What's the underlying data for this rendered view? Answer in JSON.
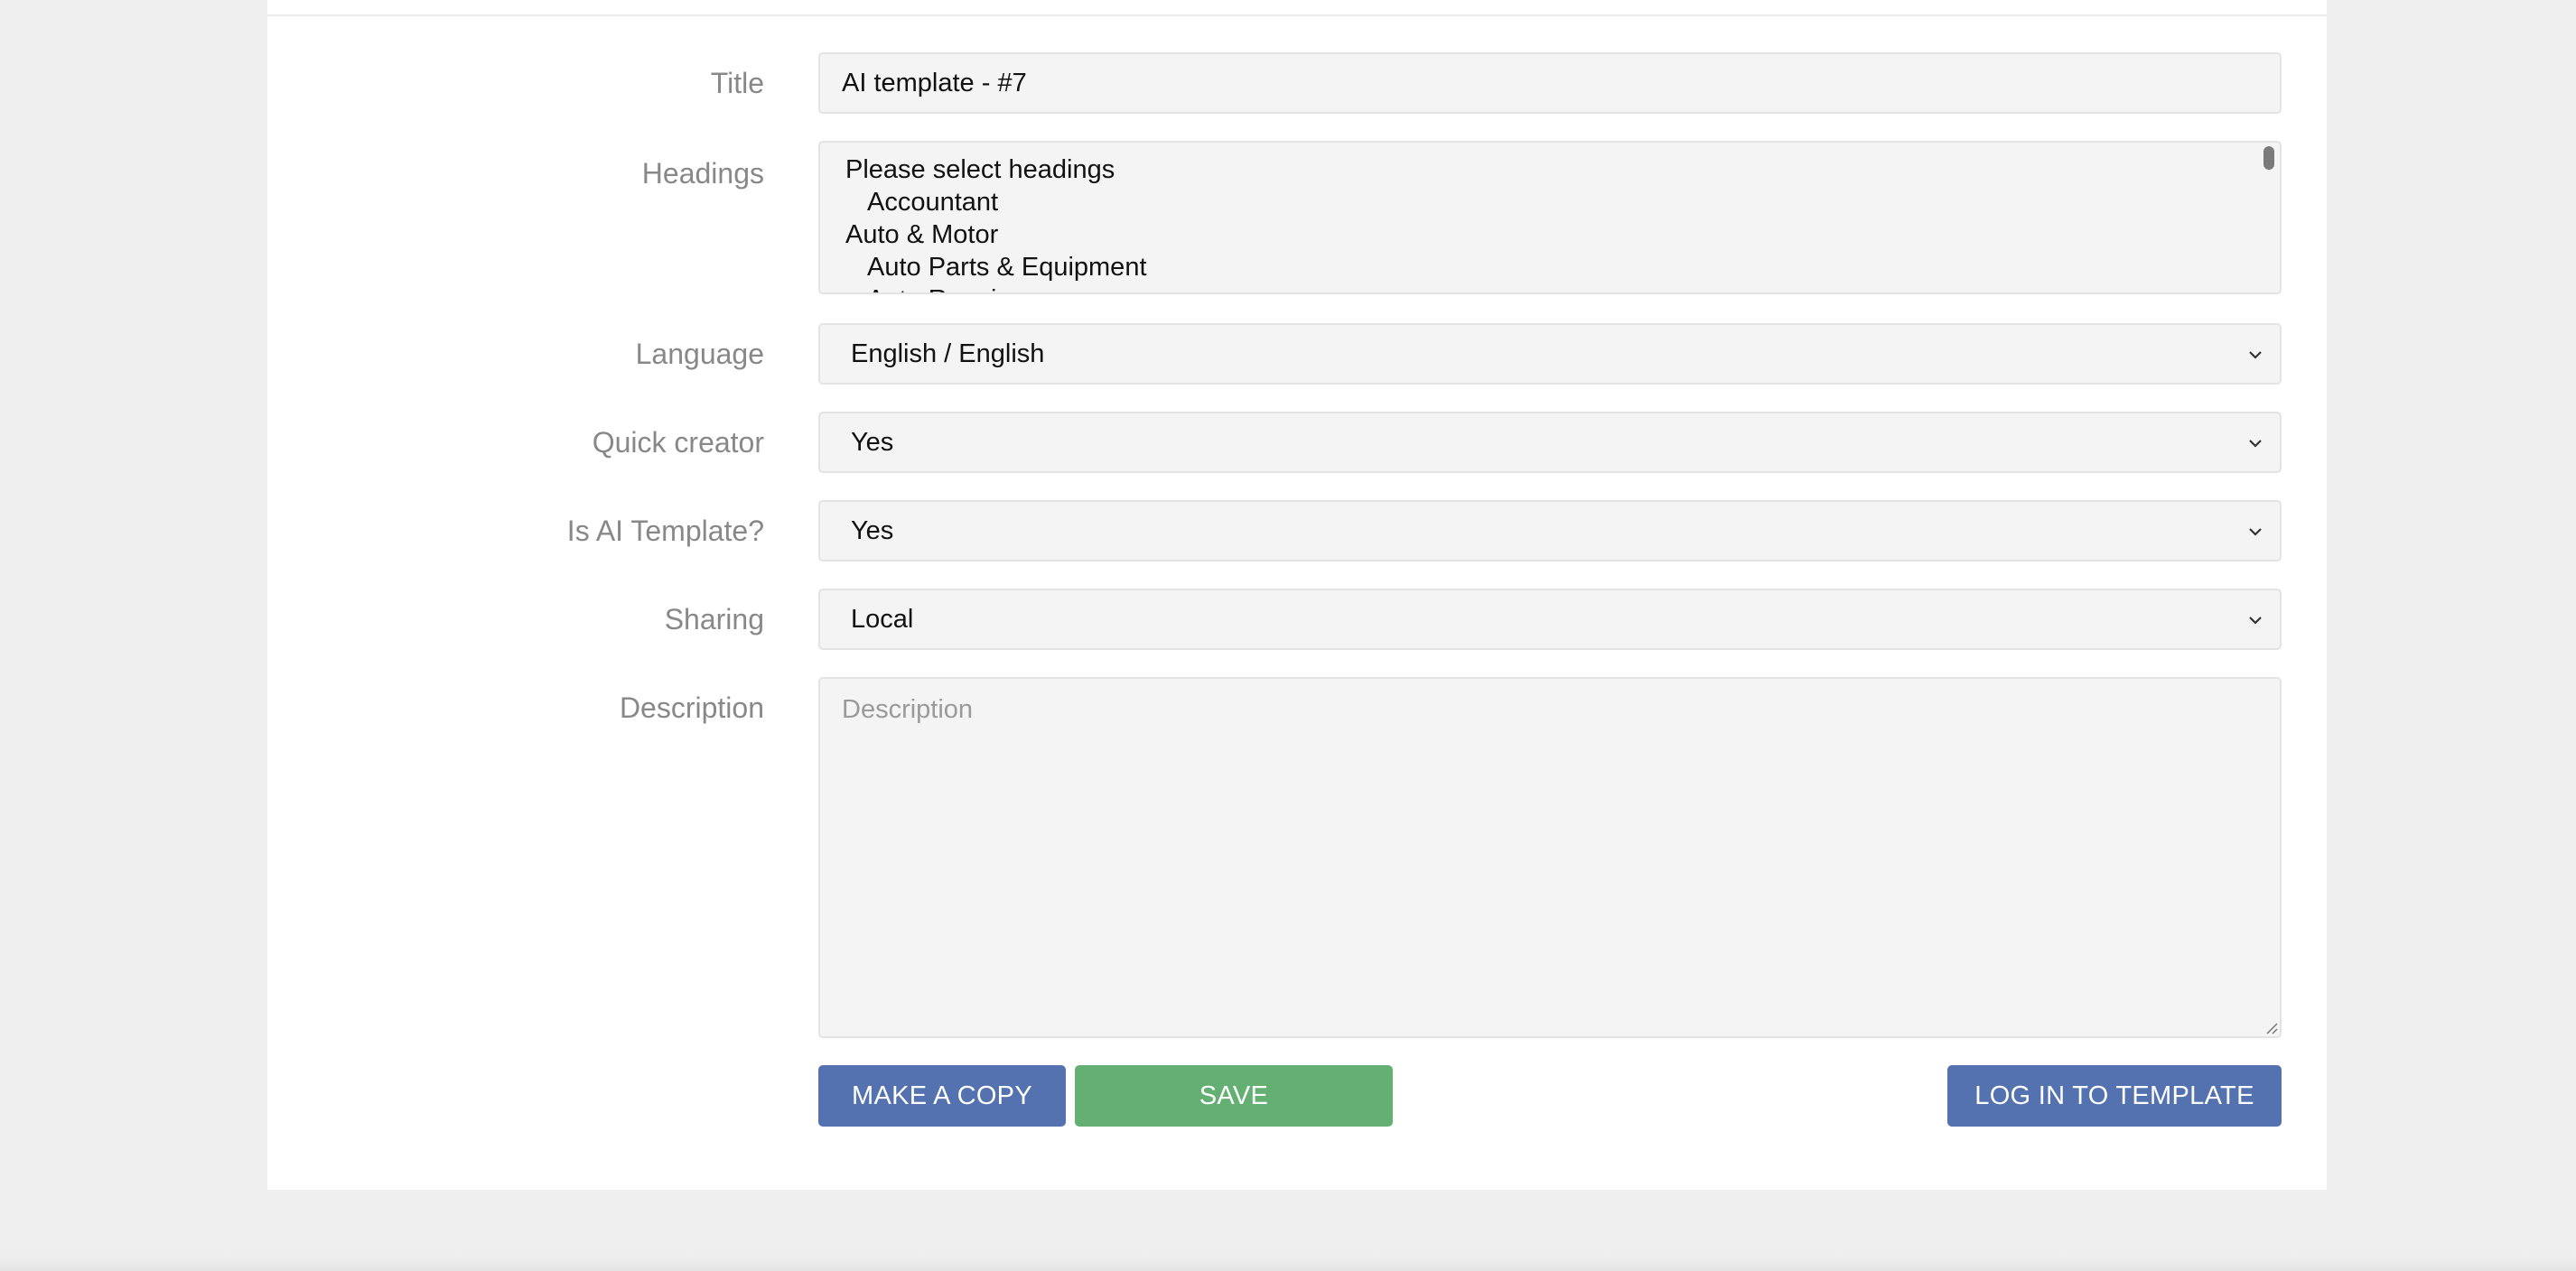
{
  "form": {
    "title": {
      "label": "Title",
      "value": "AI template - #7"
    },
    "headings": {
      "label": "Headings",
      "options": [
        {
          "text": "Please select headings",
          "indent": false
        },
        {
          "text": "Accountant",
          "indent": true
        },
        {
          "text": "Auto & Motor",
          "indent": false
        },
        {
          "text": "Auto Parts & Equipment",
          "indent": true
        },
        {
          "text": "Auto Repair",
          "indent": true
        }
      ]
    },
    "language": {
      "label": "Language",
      "value": "English / English"
    },
    "quick_creator": {
      "label": "Quick creator",
      "value": "Yes"
    },
    "is_ai_template": {
      "label": "Is AI Template?",
      "value": "Yes"
    },
    "sharing": {
      "label": "Sharing",
      "value": "Local"
    },
    "description": {
      "label": "Description",
      "placeholder": "Description",
      "value": ""
    }
  },
  "buttons": {
    "make_copy": "MAKE A COPY",
    "save": "SAVE",
    "log_in": "LOG IN TO TEMPLATE"
  },
  "colors": {
    "primary_blue": "#5472b0",
    "save_green": "#63b072",
    "label_gray": "#888888",
    "field_bg": "#f4f4f4"
  },
  "icons": {
    "select_arrow": "chevron-down-icon",
    "textarea_resize": "resize-grip-icon"
  }
}
